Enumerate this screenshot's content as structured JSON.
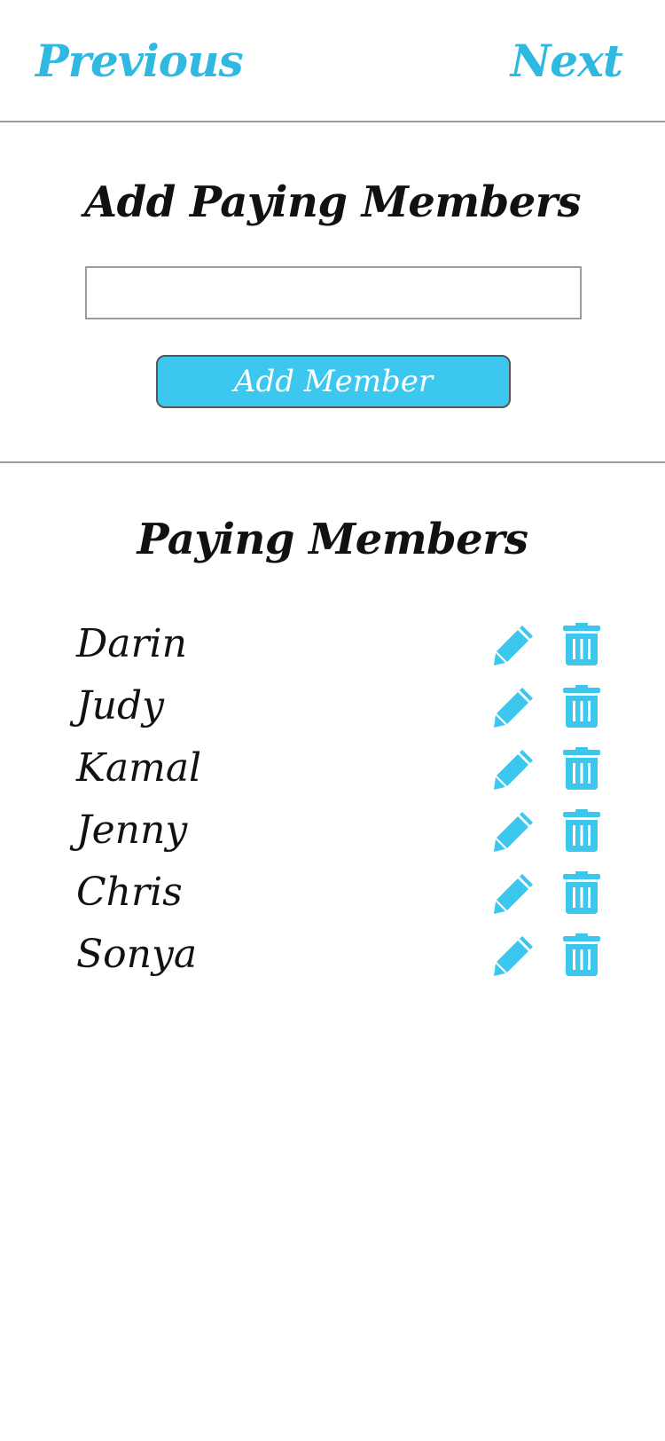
{
  "nav": {
    "previous_label": "Previous",
    "next_label": "Next"
  },
  "add_section": {
    "title": "Add Paying Members",
    "input_value": "",
    "button_label": "Add Member"
  },
  "members_section": {
    "title": "Paying Members",
    "members": [
      {
        "name": "Darin"
      },
      {
        "name": "Judy"
      },
      {
        "name": "Kamal"
      },
      {
        "name": "Jenny"
      },
      {
        "name": "Chris"
      },
      {
        "name": "Sonya"
      }
    ]
  },
  "icons": {
    "edit": "pencil-icon",
    "delete": "trash-icon"
  },
  "colors": {
    "accent": "#3cc8ee",
    "nav_link": "#2fb9e0",
    "divider": "#9a9a9a",
    "text": "#111111"
  }
}
